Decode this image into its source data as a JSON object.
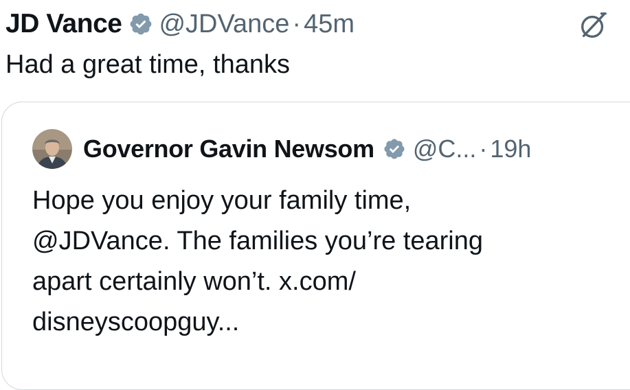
{
  "tweet": {
    "author_name": "JD Vance",
    "author_handle": "@JDVance",
    "separator": "·",
    "time": "45m",
    "text": "Had a great time, thanks"
  },
  "quoted_tweet": {
    "author_name": "Governor Gavin Newsom",
    "author_handle": "@C...",
    "separator": "·",
    "time": "19h",
    "lines": [
      "Hope you enjoy your family time,",
      "@JDVance. The families you’re tearing",
      "apart certainly won’t. x.com/",
      "disneyscoopguy..."
    ]
  },
  "icons": {
    "verified": "verified-badge-icon",
    "grok": "grok-icon",
    "avatar": "avatar"
  },
  "colors": {
    "text": "#0f1419",
    "secondary": "#536471",
    "verified_badge": "#829aab",
    "border": "#cfd9de"
  }
}
